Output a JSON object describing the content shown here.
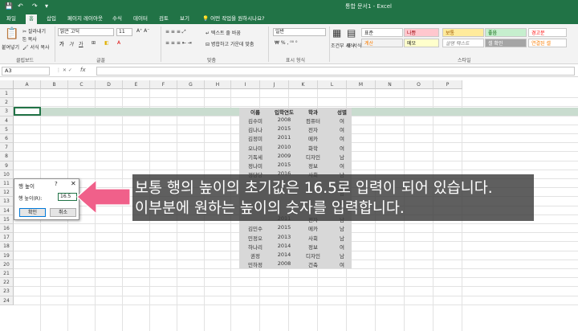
{
  "window": {
    "title": "통합 문서1 - Excel"
  },
  "tabs": [
    "파일",
    "홈",
    "삽입",
    "페이지 레이아웃",
    "수식",
    "데이터",
    "검토",
    "보기"
  ],
  "active_tab": 1,
  "tell_me": "어떤 작업을 원하시나요?",
  "ribbon": {
    "paste_label": "붙여넣기",
    "cut_label": "잘라내기",
    "copy_label": "복사",
    "format_painter_label": "서식 복사",
    "font_name": "맑은 고딕",
    "font_size": "11",
    "wrap_text_label": "텍스트 줄 바꿈",
    "merge_label": "병합하고 가운데 맞춤",
    "number_format": "일반",
    "cond_format_label": "조건부 서식",
    "table_format_label": "표 서식",
    "group_labels": {
      "clipboard": "클립보드",
      "font": "글꼴",
      "alignment": "맞춤",
      "number": "표시 형식",
      "styles": "스타일"
    },
    "styles": [
      {
        "label": "표준",
        "bg": "#ffffff",
        "fg": "#222222"
      },
      {
        "label": "나쁨",
        "bg": "#ffc7ce",
        "fg": "#9c0006"
      },
      {
        "label": "보통",
        "bg": "#ffeb9c",
        "fg": "#9c5700"
      },
      {
        "label": "좋음",
        "bg": "#c6efce",
        "fg": "#006100"
      },
      {
        "label": "경고문",
        "bg": "#ffffff",
        "fg": "#ff0000"
      },
      {
        "label": "계산",
        "bg": "#f2f2f2",
        "fg": "#fa7d00"
      },
      {
        "label": "메모",
        "bg": "#ffffcc",
        "fg": "#222222"
      },
      {
        "label": "설명 텍스트",
        "bg": "#ffffff",
        "fg": "#7f7f7f"
      },
      {
        "label": "셀 확인",
        "bg": "#a5a5a5",
        "fg": "#ffffff"
      },
      {
        "label": "연결된 셀",
        "bg": "#ffffff",
        "fg": "#fa7d00"
      }
    ]
  },
  "formula_bar": {
    "name_box": "A3",
    "fx": "fx",
    "formula": ""
  },
  "columns": [
    "A",
    "B",
    "C",
    "D",
    "E",
    "F",
    "G",
    "H",
    "I",
    "J",
    "K",
    "L",
    "M",
    "N",
    "O",
    "P"
  ],
  "rows": [
    "1",
    "2",
    "3",
    "4",
    "5",
    "6",
    "7",
    "8",
    "9",
    "10",
    "11",
    "12",
    "13",
    "14",
    "15",
    "16",
    "17",
    "18",
    "19",
    "20",
    "21",
    "22",
    "23",
    "24"
  ],
  "table": {
    "headers": [
      "이름",
      "입학연도",
      "학과",
      "성별"
    ],
    "rows": [
      [
        "김수미",
        "2008",
        "컴퓨터",
        "여"
      ],
      [
        "김나나",
        "2015",
        "전자",
        "여"
      ],
      [
        "김정미",
        "2011",
        "메카",
        "여"
      ],
      [
        "오나미",
        "2010",
        "화학",
        "여"
      ],
      [
        "기독세",
        "2009",
        "디자인",
        "남"
      ],
      [
        "정나미",
        "2015",
        "정보",
        "여"
      ],
      [
        "정당당",
        "2016",
        "사회",
        "남"
      ],
      [
        "",
        "",
        "",
        "남"
      ],
      [
        "",
        "",
        "",
        "남"
      ],
      [
        "",
        "",
        "",
        "남"
      ],
      [
        "",
        "",
        "",
        "남"
      ],
      [
        "",
        "2011",
        "전자",
        "남"
      ],
      [
        "김민수",
        "2015",
        "메카",
        "남"
      ],
      [
        "민정오",
        "2013",
        "사회",
        "남"
      ],
      [
        "하나리",
        "2014",
        "정보",
        "여"
      ],
      [
        "권정",
        "2014",
        "디자인",
        "남"
      ],
      [
        "민하정",
        "2008",
        "건축",
        "여"
      ]
    ]
  },
  "dialog": {
    "title": "행 높이",
    "help": "?",
    "close": "✕",
    "label": "행 높이(R):",
    "value": "16.5",
    "ok": "확인",
    "cancel": "취소"
  },
  "annotation": {
    "line1": "보통 행의 높이의 초기값은 16.5로 입력이 되어 있습니다.",
    "line2": "이부분에 원하는 높이의 숫자를 입력합니다."
  },
  "colors": {
    "excel_green": "#217346",
    "arrow_pink": "#f0608a",
    "data_bg": "#d8d8d8",
    "row_highlight": "#c9dccf"
  }
}
